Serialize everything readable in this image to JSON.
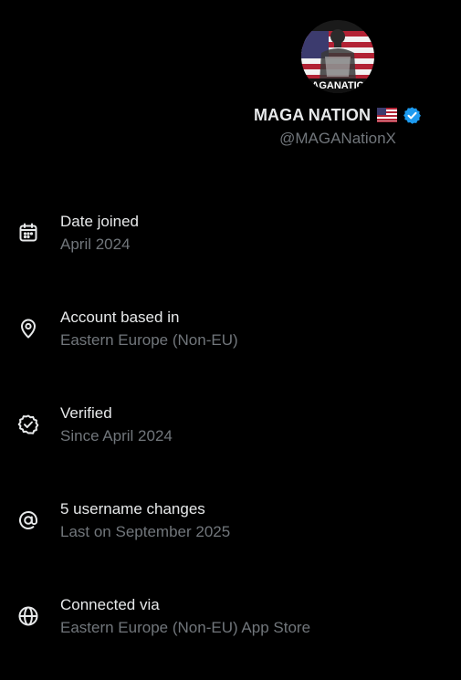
{
  "profile": {
    "avatar_text": "AGANATIC",
    "display_name": "MAGA NATION",
    "flag_emoji": "flag-us-icon",
    "verified_icon": "verified-badge-icon",
    "handle": "@MAGANationX"
  },
  "info": [
    {
      "icon": "calendar-icon",
      "title": "Date joined",
      "subtitle": "April 2024"
    },
    {
      "icon": "location-pin-icon",
      "title": "Account based in",
      "subtitle": "Eastern Europe (Non-EU)"
    },
    {
      "icon": "verified-check-icon",
      "title": "Verified",
      "subtitle": "Since April 2024"
    },
    {
      "icon": "at-sign-icon",
      "title": "5 username changes",
      "subtitle": "Last on September 2025"
    },
    {
      "icon": "globe-icon",
      "title": "Connected via",
      "subtitle": "Eastern Europe (Non-EU) App Store"
    }
  ],
  "colors": {
    "background": "#000000",
    "primary_text": "#e7e9ea",
    "secondary_text": "#71767b",
    "verified_blue": "#1d9bf0"
  }
}
